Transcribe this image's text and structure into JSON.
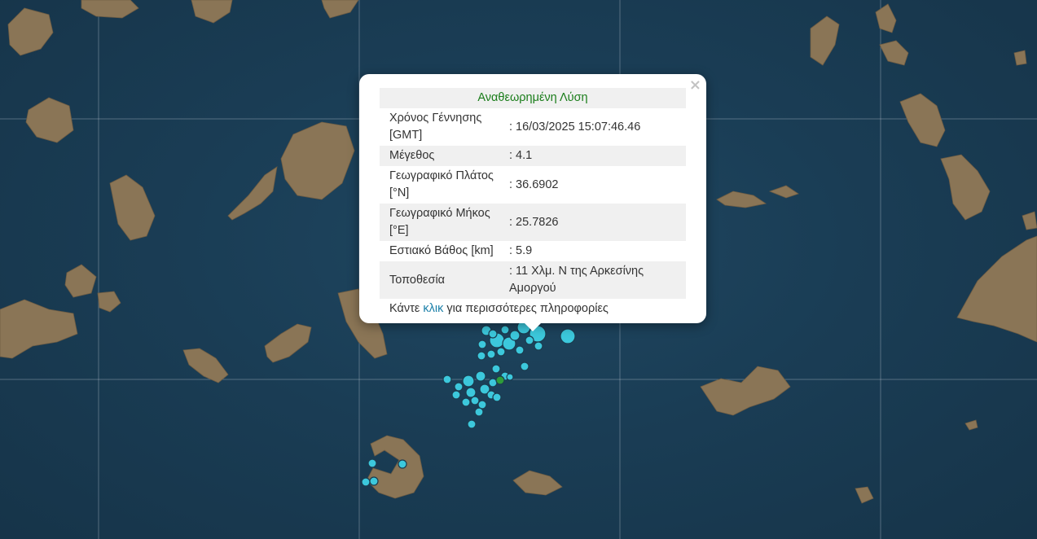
{
  "popup": {
    "title": "Αναθεωρημένη Λύση",
    "rows": [
      {
        "label": "Χρόνος Γέννησης [GMT]",
        "value": ": 16/03/2025 15:07:46.46"
      },
      {
        "label": "Μέγεθος",
        "value": ": 4.1"
      },
      {
        "label": "Γεωγραφικό Πλάτος [°N]",
        "value": ": 36.6902"
      },
      {
        "label": "Γεωγραφικό Μήκος [°E]",
        "value": ": 25.7826"
      },
      {
        "label": "Εστιακό Βάθος [km]",
        "value": ": 5.9"
      },
      {
        "label": "Τοποθεσία",
        "value": ": 11 Χλμ. Ν της Αρκεσίνης Αμοργού"
      }
    ],
    "more_prefix": "Κάντε ",
    "more_link": "κλικ",
    "more_suffix": " για περισσότερες πληροφορίες",
    "close_glyph": "×"
  },
  "colors": {
    "sea": "#1a3d55",
    "land": "#8a7556",
    "quake_marker": "#3cc8dc",
    "selected_marker": "#2e9c3a",
    "popup_title": "#1a7d1a",
    "link": "#1a7fa8"
  },
  "icons": {
    "close": "close-icon"
  }
}
